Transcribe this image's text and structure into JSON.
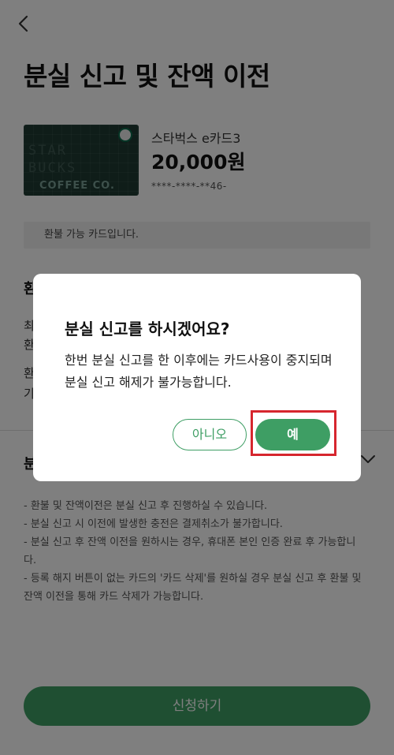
{
  "header": {
    "back_icon": "chevron-left-icon",
    "title": "분실 신고 및 잔액 이전"
  },
  "card": {
    "image_text_top": "STAR\nBUCKS",
    "image_text_bottom": "COFFEE CO.",
    "name": "스타벅스 e카드3",
    "amount": "20,000원",
    "number": "****-****-**46-"
  },
  "notice": "환불 가능 카드입니다.",
  "section1": {
    "heading_partial": "환",
    "lines_partial": [
      "최",
      "환",
      "환",
      "기"
    ]
  },
  "section2": {
    "heading_partial": "분",
    "chevron_icon": "chevron-down-icon"
  },
  "guide": [
    "- 환불 및 잔액이전은 분실 신고 후 진행하실 수 있습니다.",
    "- 분실 신고 시 이전에 발생한 충전은 결제취소가 불가합니다.",
    "- 분실 신고 후 잔액 이전을 원하시는 경우, 휴대폰 본인 인증 완료 후 가능합니다.",
    "- 등록 해지 버튼이 없는 카드의 '카드 삭제'를 원하실 경우 분실 신고 후 환불 및 잔액 이전을 통해 카드 삭제가 가능합니다."
  ],
  "apply_button": "신청하기",
  "dialog": {
    "title": "분실 신고를 하시겠어요?",
    "message": "한번 분실 신고를 한 이후에는 카드사용이 중지되며 분실 신고 해제가 불가능합니다.",
    "no_label": "아니오",
    "yes_label": "예"
  },
  "colors": {
    "accent": "#3e9e64",
    "highlight": "#d6262e",
    "card_bg": "#1e3a33"
  }
}
